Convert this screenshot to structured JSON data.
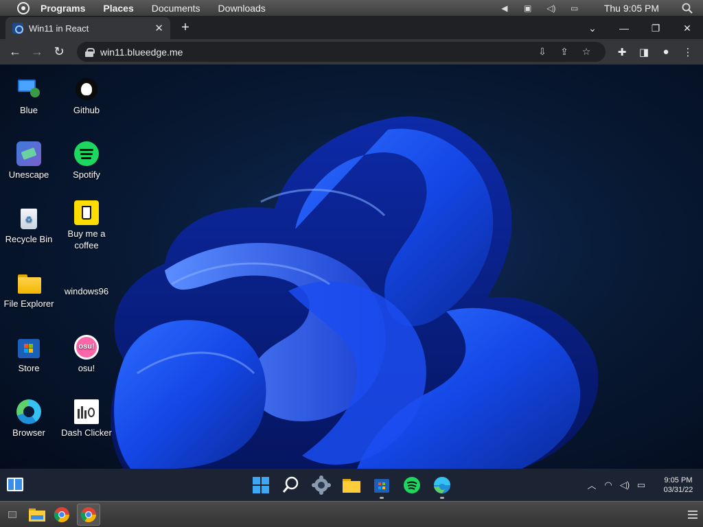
{
  "system_top": {
    "menus": [
      "Programs",
      "Places",
      "Documents",
      "Downloads"
    ],
    "clock": "Thu 9:05 PM"
  },
  "browser": {
    "tab_title": "Win11 in React",
    "url": "win11.blueedge.me"
  },
  "desktop": {
    "icons": [
      {
        "label": "Blue",
        "icon": "user-monitor-icon"
      },
      {
        "label": "Github",
        "icon": "github-icon"
      },
      {
        "label": "Unescape",
        "icon": "unescape-icon"
      },
      {
        "label": "Spotify",
        "icon": "spotify-icon"
      },
      {
        "label": "Recycle Bin",
        "icon": "recycle-bin-icon"
      },
      {
        "label": "Buy me a coffee",
        "icon": "coffee-icon"
      },
      {
        "label": "File Explorer",
        "icon": "folder-icon"
      },
      {
        "label": "windows96",
        "icon": "windows96-icon"
      },
      {
        "label": "Store",
        "icon": "store-icon"
      },
      {
        "label": "osu!",
        "icon": "osu-icon"
      },
      {
        "label": "Browser",
        "icon": "edge-icon"
      },
      {
        "label": "Dash Clicker",
        "icon": "dash-clicker-icon"
      }
    ]
  },
  "taskbar": {
    "time": "9:05 PM",
    "date": "03/31/22"
  },
  "colors": {
    "accent": "#1a73e8",
    "spotify": "#1ed760",
    "taskbar": "#1c2433",
    "chrome_dark": "#202124"
  }
}
